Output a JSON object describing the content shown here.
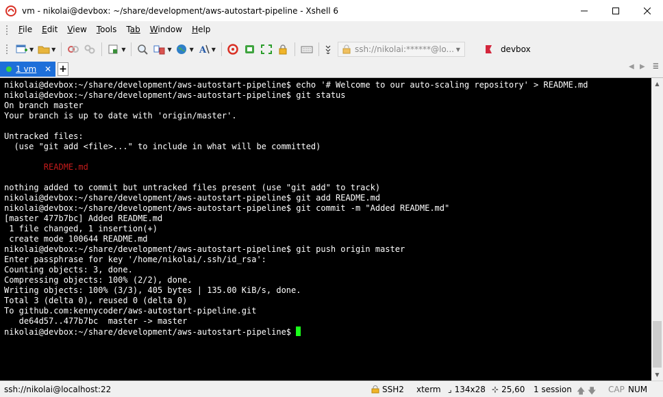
{
  "window": {
    "title": "vm - nikolai@devbox: ~/share/development/aws-autostart-pipeline - Xshell 6"
  },
  "menu": [
    {
      "key": "F",
      "rest": "ile"
    },
    {
      "key": "E",
      "rest": "dit"
    },
    {
      "key": "V",
      "rest": "iew"
    },
    {
      "key": "T",
      "rest": "ools"
    },
    {
      "key": "T",
      "rest": "ab"
    },
    {
      "key": "W",
      "rest": "indow"
    },
    {
      "key": "H",
      "rest": "elp"
    }
  ],
  "toolbar": {
    "address": "ssh://nikolai:******@lo...",
    "session_label": "devbox"
  },
  "tabs": {
    "active_label": "1 vm"
  },
  "terminal": {
    "lines": [
      "nikolai@devbox:~/share/development/aws-autostart-pipeline$ echo '# Welcome to our auto-scaling repository' > README.md",
      "nikolai@devbox:~/share/development/aws-autostart-pipeline$ git status",
      "On branch master",
      "Your branch is up to date with 'origin/master'.",
      "",
      "Untracked files:",
      "  (use \"git add <file>...\" to include in what will be committed)",
      "",
      "        README.md",
      "",
      "nothing added to commit but untracked files present (use \"git add\" to track)",
      "nikolai@devbox:~/share/development/aws-autostart-pipeline$ git add README.md",
      "nikolai@devbox:~/share/development/aws-autostart-pipeline$ git commit -m \"Added README.md\"",
      "[master 477b7bc] Added README.md",
      " 1 file changed, 1 insertion(+)",
      " create mode 100644 README.md",
      "nikolai@devbox:~/share/development/aws-autostart-pipeline$ git push origin master",
      "Enter passphrase for key '/home/nikolai/.ssh/id_rsa':",
      "Counting objects: 3, done.",
      "Compressing objects: 100% (2/2), done.",
      "Writing objects: 100% (3/3), 405 bytes | 135.00 KiB/s, done.",
      "Total 3 (delta 0), reused 0 (delta 0)",
      "To github.com:kennycoder/aws-autostart-pipeline.git",
      "   de64d57..477b7bc  master -> master"
    ],
    "red_line_index": 8,
    "prompt": "nikolai@devbox:~/share/development/aws-autostart-pipeline$ ",
    "colors": {
      "background": "#000000",
      "foreground": "#ffffff",
      "untracked": "#c51b1b",
      "cursor": "#1aff1a"
    }
  },
  "status": {
    "connection": "ssh://nikolai@localhost:22",
    "protocol": "SSH2",
    "terminal_type": "xterm",
    "size": "134x28",
    "cursor_pos": "25,60",
    "sessions": "1 session",
    "cap": "CAP",
    "num": "NUM"
  }
}
